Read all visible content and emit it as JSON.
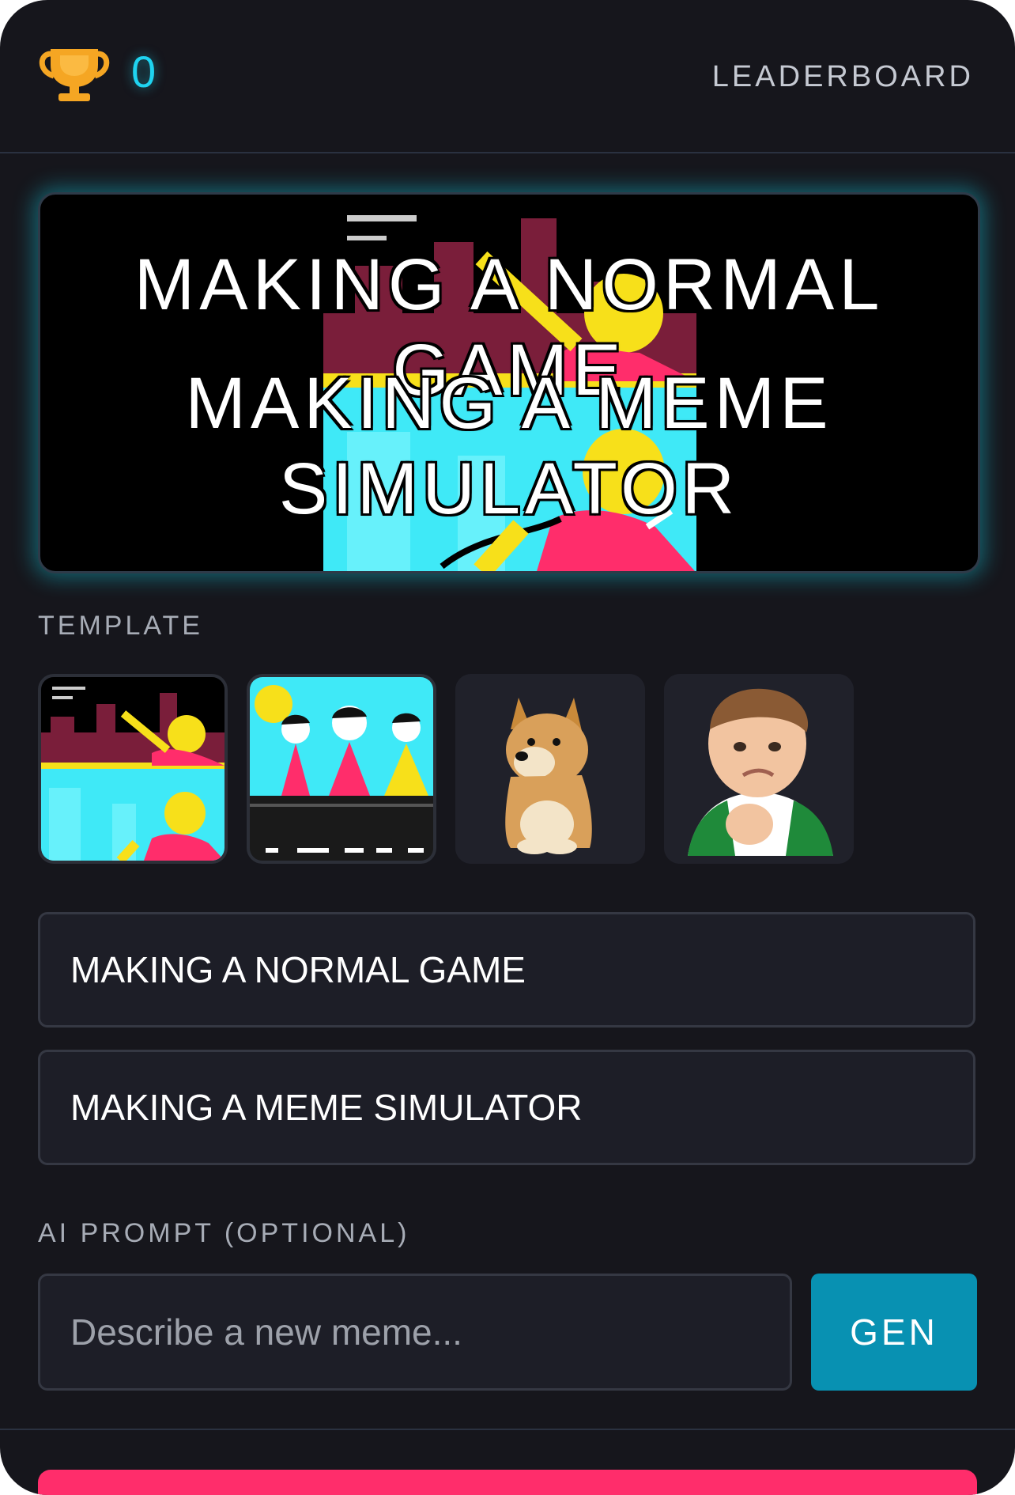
{
  "header": {
    "score": "0",
    "leaderboard_label": "LEADERBOARD"
  },
  "preview": {
    "top_caption": "MAKING A NORMAL GAME",
    "bottom_caption": "MAKING A MEME SIMULATOR"
  },
  "template": {
    "label": "TEMPLATE",
    "items": [
      {
        "name": "two-panel-cartoon",
        "selected": true
      },
      {
        "name": "three-dancers-cartoon",
        "selected": false
      },
      {
        "name": "doge",
        "selected": false
      },
      {
        "name": "success-kid",
        "selected": false
      }
    ]
  },
  "fields": {
    "top_text": "MAKING A NORMAL GAME",
    "bottom_text": "MAKING A MEME SIMULATOR"
  },
  "ai_prompt": {
    "label": "AI PROMPT (OPTIONAL)",
    "placeholder": "Describe a new meme...",
    "button_label": "GEN"
  },
  "colors": {
    "accent_cyan": "#1fd3f0",
    "gen_button": "#0891b2",
    "primary_action": "#ff2d6b",
    "background": "#16161c"
  }
}
